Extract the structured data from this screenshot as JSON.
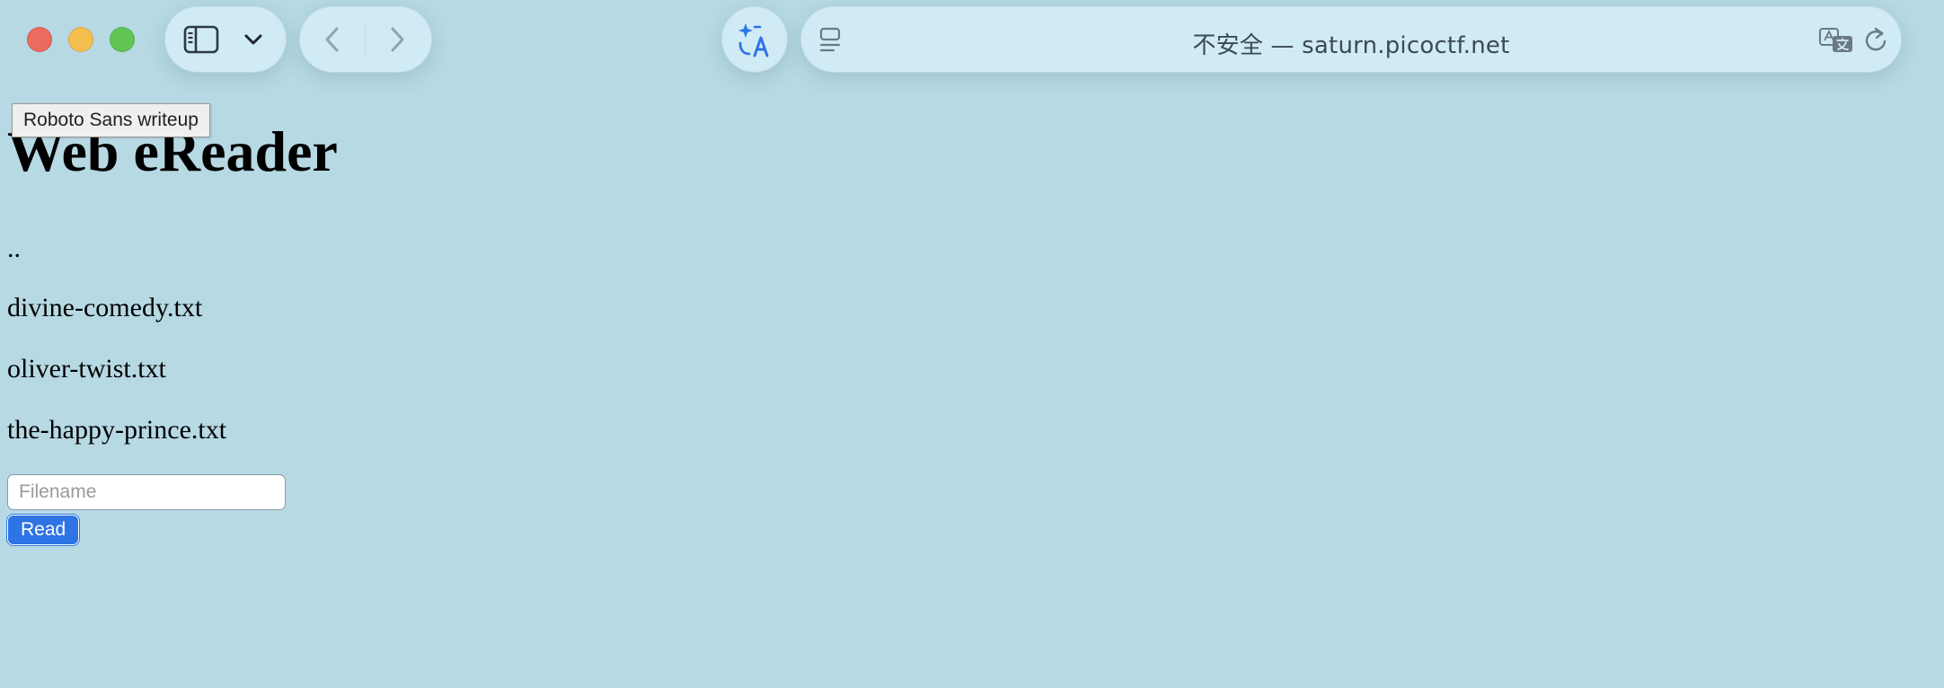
{
  "browser": {
    "address": "不安全 — saturn.picoctf.net",
    "tooltip": "Roboto Sans writeup",
    "icons": [
      "sidebar-icon",
      "chevron-down-icon",
      "back-icon",
      "forward-icon",
      "ai-translate-icon",
      "reader-icon",
      "page-translate-icon",
      "reload-icon"
    ],
    "colors": {
      "close": "#ec6a5e",
      "minimize": "#f4bf4f",
      "maximize": "#61c554",
      "accent": "#2f74e4"
    }
  },
  "page": {
    "title": "Web eReader",
    "files": [
      "..",
      "divine-comedy.txt",
      "oliver-twist.txt",
      "the-happy-prince.txt"
    ],
    "form": {
      "filename_value": "",
      "filename_placeholder": "Filename",
      "read_label": "Read"
    }
  }
}
